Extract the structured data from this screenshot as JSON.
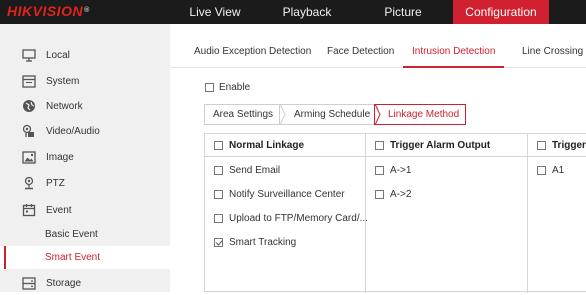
{
  "brand": {
    "logo": "HIKVISION",
    "reg": "®"
  },
  "topnav": [
    {
      "label": "Live View"
    },
    {
      "label": "Playback"
    },
    {
      "label": "Picture"
    },
    {
      "label": "Configuration",
      "active": true
    }
  ],
  "sidebar": {
    "items": [
      {
        "label": "Local",
        "icon": "monitor-icon"
      },
      {
        "label": "System",
        "icon": "system-icon"
      },
      {
        "label": "Network",
        "icon": "globe-icon"
      },
      {
        "label": "Video/Audio",
        "icon": "video-audio-icon"
      },
      {
        "label": "Image",
        "icon": "image-icon"
      },
      {
        "label": "PTZ",
        "icon": "ptz-icon"
      },
      {
        "label": "Event",
        "icon": "calendar-icon"
      }
    ],
    "sub_items": [
      {
        "label": "Basic Event"
      },
      {
        "label": "Smart Event",
        "active": true
      }
    ],
    "storage": {
      "label": "Storage",
      "icon": "storage-icon"
    }
  },
  "tabs": [
    {
      "label": "Audio Exception Detection"
    },
    {
      "label": "Face Detection"
    },
    {
      "label": "Intrusion Detection",
      "active": true
    },
    {
      "label": "Line Crossing De"
    }
  ],
  "enable": {
    "label": "Enable",
    "checked": false
  },
  "subtabs": [
    {
      "label": "Area Settings"
    },
    {
      "label": "Arming Schedule"
    },
    {
      "label": "Linkage Method",
      "active": true
    }
  ],
  "linkage": {
    "normal": {
      "header": "Normal Linkage",
      "items": [
        {
          "label": "Send Email",
          "checked": false
        },
        {
          "label": "Notify Surveillance Center",
          "checked": false
        },
        {
          "label": "Upload to FTP/Memory Card/...",
          "checked": false
        },
        {
          "label": "Smart Tracking",
          "checked": true
        }
      ]
    },
    "alarm_output": {
      "header": "Trigger Alarm Output",
      "items": [
        {
          "label": "A->1",
          "checked": false
        },
        {
          "label": "A->2",
          "checked": false
        }
      ]
    },
    "third": {
      "header": "Trigger I",
      "items": [
        {
          "label": "A1",
          "checked": false
        }
      ]
    }
  },
  "colors": {
    "accent": "#d1202f",
    "topbar": "#1b1b1b",
    "sidebar": "#f0f0f0"
  }
}
